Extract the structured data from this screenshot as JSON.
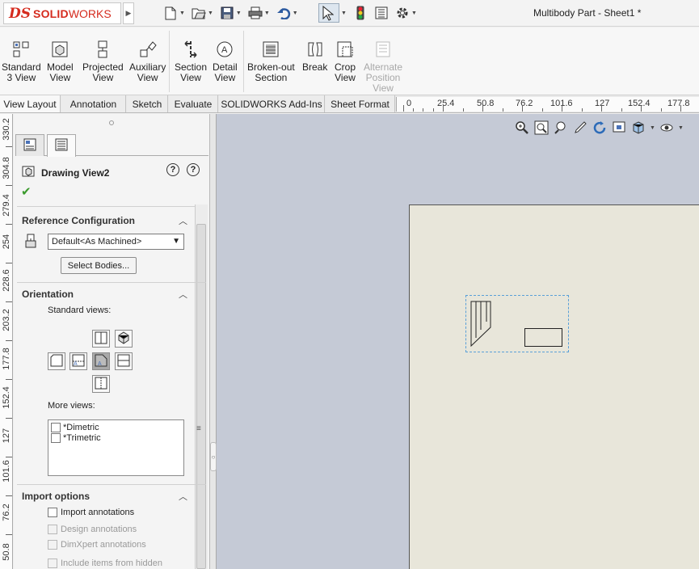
{
  "app": {
    "logo_prefix": "DS",
    "logo_bold": "SOLID",
    "logo_rest": "WORKS",
    "document_title": "Multibody Part - Sheet1 *"
  },
  "quick_access": [
    "new-document",
    "open",
    "save",
    "print",
    "undo",
    "select",
    "rebuild",
    "file-properties",
    "options"
  ],
  "commands": [
    {
      "name": "standard-3-view-button",
      "label": "Standard\n3 View",
      "enabled": true
    },
    {
      "name": "model-view-button",
      "label": "Model\nView",
      "enabled": true
    },
    {
      "name": "projected-view-button",
      "label": "Projected\nView",
      "enabled": true
    },
    {
      "name": "auxiliary-view-button",
      "label": "Auxiliary\nView",
      "enabled": true
    },
    {
      "name": "section-view-button",
      "label": "Section\nView",
      "enabled": true
    },
    {
      "name": "detail-view-button",
      "label": "Detail\nView",
      "enabled": true
    },
    {
      "name": "broken-out-section-button",
      "label": "Broken-out\nSection",
      "enabled": true
    },
    {
      "name": "break-button",
      "label": "Break",
      "enabled": true
    },
    {
      "name": "crop-view-button",
      "label": "Crop\nView",
      "enabled": true
    },
    {
      "name": "alternate-position-view-button",
      "label": "Alternate\nPosition\nView",
      "enabled": false
    }
  ],
  "tabs": [
    "View Layout",
    "Annotation",
    "Sketch",
    "Evaluate",
    "SOLIDWORKS Add-Ins",
    "Sheet Format"
  ],
  "active_tab": "View Layout",
  "top_ruler": [
    "0",
    "25.4",
    "50.8",
    "76.2",
    "101.6",
    "127",
    "152.4",
    "177.8"
  ],
  "left_ruler": [
    "330.2",
    "304.8",
    "279.4",
    "254",
    "228.6",
    "203.2",
    "177.8",
    "152.4",
    "127",
    "101.6",
    "76.2",
    "50.8"
  ],
  "property_manager": {
    "title": "Drawing View2",
    "help_label": "?",
    "ok_symbol": "✔",
    "reference_configuration": {
      "heading": "Reference Configuration",
      "selected": "Default<As Machined>",
      "select_bodies_label": "Select Bodies..."
    },
    "orientation": {
      "heading": "Orientation",
      "standard_views_label": "Standard views:",
      "more_views_label": "More views:",
      "more_views": [
        "*Dimetric",
        "*Trimetric"
      ]
    },
    "import_options": {
      "heading": "Import options",
      "items": [
        {
          "label": "Import annotations",
          "enabled": true,
          "checked": false
        },
        {
          "label": "Design annotations",
          "enabled": false,
          "checked": false
        },
        {
          "label": "DimXpert annotations",
          "enabled": false,
          "checked": false
        },
        {
          "label": "Include items from hidden",
          "enabled": false,
          "checked": false
        }
      ]
    }
  },
  "colors": {
    "brand": "#d52b1e",
    "canvas_bg": "#c5cad6",
    "sheet_bg": "#e8e6da",
    "selection_dash": "#5aa0d8",
    "ok_green": "#3a9a2c"
  }
}
